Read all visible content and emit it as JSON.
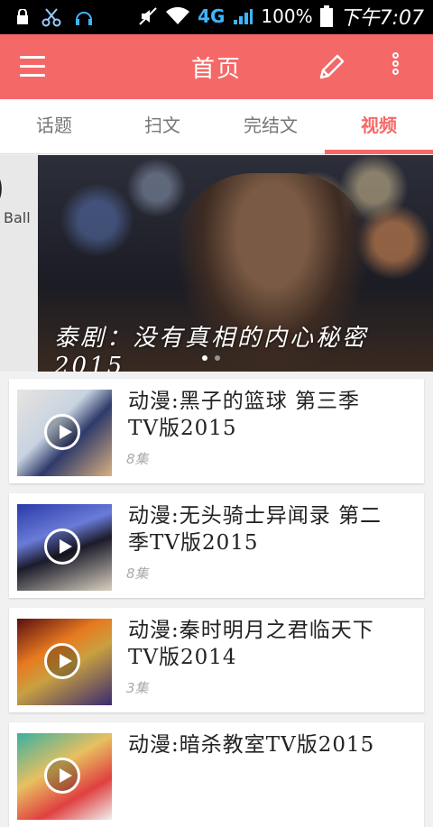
{
  "status_bar": {
    "network": "4G",
    "battery": "100%",
    "time": "下午7:07",
    "icons": [
      "lock-icon",
      "scissors-icon",
      "headset-icon",
      "mute-icon",
      "wifi-icon",
      "signal-icon",
      "battery-icon"
    ]
  },
  "app_bar": {
    "title": "首页",
    "icons": [
      "menu-icon",
      "edit-icon",
      "more-icon"
    ]
  },
  "tabs": [
    {
      "label": "话题",
      "active": false
    },
    {
      "label": "扫文",
      "active": false
    },
    {
      "label": "完结文",
      "active": false
    },
    {
      "label": "视频",
      "active": true
    }
  ],
  "banner": {
    "prev_text": "Ball",
    "caption": "泰剧：没有真相的内心秘密 2015",
    "dots": 2,
    "active_dot": 0
  },
  "videos": [
    {
      "title": "动漫:黑子的篮球 第三季TV版2015",
      "episodes": "8集"
    },
    {
      "title": "动漫:无头骑士异闻录 第二季TV版2015",
      "episodes": "8集"
    },
    {
      "title": "动漫:秦时明月之君临天下TV版2014",
      "episodes": "3集"
    },
    {
      "title": "动漫:暗杀教室TV版2015",
      "episodes": ""
    }
  ],
  "colors": {
    "accent": "#f56868"
  }
}
